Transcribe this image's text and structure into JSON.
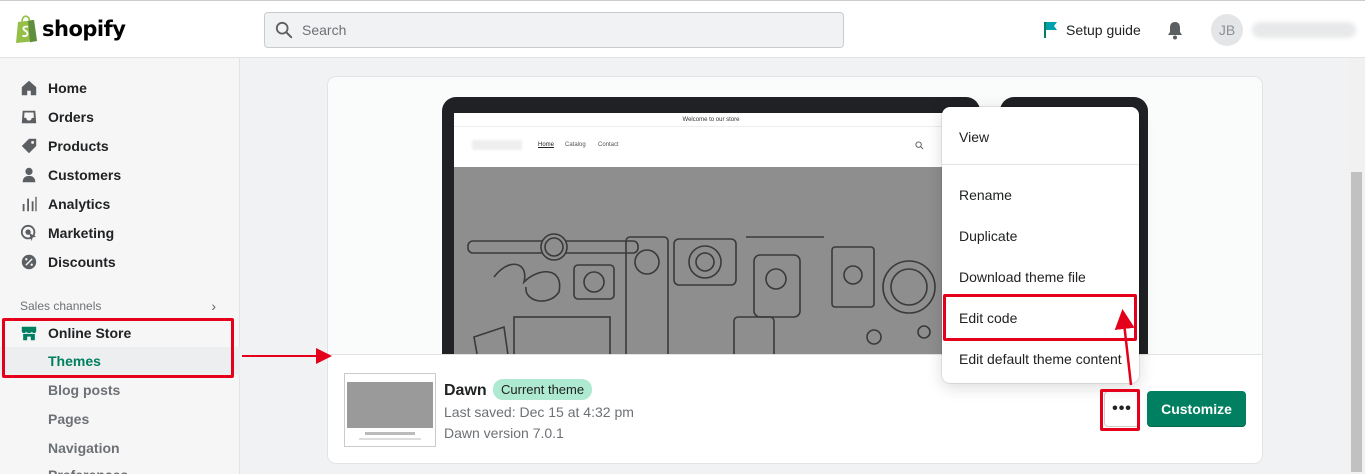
{
  "brand": {
    "name": "shopify"
  },
  "search": {
    "placeholder": "Search"
  },
  "header": {
    "setup_guide": "Setup guide",
    "avatar_initials": "JB"
  },
  "sidebar": {
    "items": [
      {
        "label": "Home",
        "icon": "home-icon"
      },
      {
        "label": "Orders",
        "icon": "orders-icon"
      },
      {
        "label": "Products",
        "icon": "tag-icon"
      },
      {
        "label": "Customers",
        "icon": "person-icon"
      },
      {
        "label": "Analytics",
        "icon": "bar-chart-icon"
      },
      {
        "label": "Marketing",
        "icon": "target-icon"
      },
      {
        "label": "Discounts",
        "icon": "discount-icon"
      }
    ],
    "sales_channels_label": "Sales channels",
    "online_store": "Online Store",
    "online_store_subitems": [
      "Themes",
      "Blog posts",
      "Pages",
      "Navigation",
      "Preferences"
    ]
  },
  "preview": {
    "announcement": "Welcome to our store",
    "nav": [
      "Home",
      "Catalog",
      "Contact"
    ]
  },
  "theme": {
    "name": "Dawn",
    "badge": "Current theme",
    "last_saved": "Last saved: Dec 15 at 4:32 pm",
    "version": "Dawn version 7.0.1",
    "customize_label": "Customize",
    "more_label": "•••"
  },
  "menu": {
    "items": [
      "View",
      "Rename",
      "Duplicate",
      "Download theme file",
      "Edit code",
      "Edit default theme content"
    ]
  },
  "colors": {
    "accent": "#008060",
    "highlight": "#e4001a",
    "badge": "#aee9d1",
    "selected_text": "#007f5f"
  }
}
